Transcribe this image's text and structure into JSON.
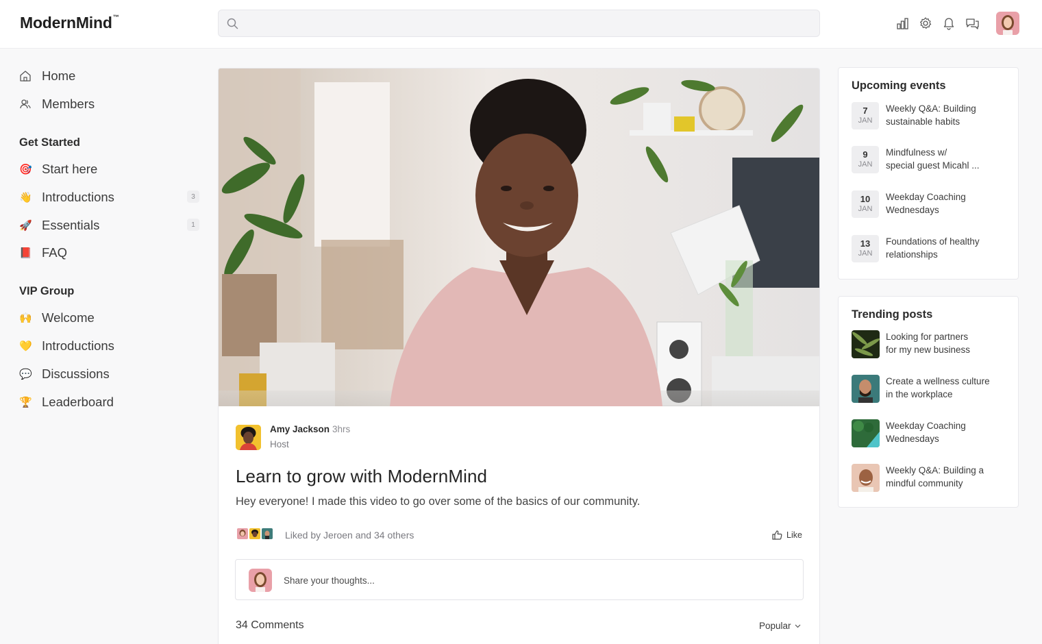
{
  "header": {
    "logo": "ModernMind",
    "logo_tm": "™",
    "search_placeholder": "",
    "icons": [
      "analytics-icon",
      "settings-icon",
      "notifications-icon",
      "messages-icon"
    ]
  },
  "sidebar": {
    "top_items": [
      {
        "label": "Home",
        "icon": "home-icon"
      },
      {
        "label": "Members",
        "icon": "members-icon"
      }
    ],
    "groups": [
      {
        "heading": "Get Started",
        "items": [
          {
            "label": "Start here",
            "icon": "🎯",
            "badge": ""
          },
          {
            "label": "Introductions",
            "icon": "👋",
            "badge": "3"
          },
          {
            "label": "Essentials",
            "icon": "🚀",
            "badge": "1"
          },
          {
            "label": "FAQ",
            "icon": "📕",
            "badge": ""
          }
        ]
      },
      {
        "heading": "VIP Group",
        "items": [
          {
            "label": "Welcome",
            "icon": "🙌",
            "badge": ""
          },
          {
            "label": "Introductions",
            "icon": "💛",
            "badge": ""
          },
          {
            "label": "Discussions",
            "icon": "💬",
            "badge": ""
          },
          {
            "label": "Leaderboard",
            "icon": "🏆",
            "badge": ""
          }
        ]
      }
    ]
  },
  "post": {
    "author_name": "Amy Jackson",
    "time": "3hrs",
    "role": "Host",
    "title": "Learn to grow with ModernMind",
    "body": "Hey everyone! I made this video to go over some of the basics of our community.",
    "likes_text": "Liked by Jeroen and 34 others",
    "like_label": "Like",
    "comment_placeholder": "Share your thoughts...",
    "comments_count": "34 Comments",
    "sort_label": "Popular"
  },
  "events": {
    "title": "Upcoming events",
    "items": [
      {
        "day": "7",
        "month": "JAN",
        "line1": "Weekly Q&A: Building",
        "line2": "sustainable habits"
      },
      {
        "day": "9",
        "month": "JAN",
        "line1": "Mindfulness w/",
        "line2": "special guest Micahl ..."
      },
      {
        "day": "10",
        "month": "JAN",
        "line1": "Weekday Coaching",
        "line2": "Wednesdays"
      },
      {
        "day": "13",
        "month": "JAN",
        "line1": "Foundations of healthy",
        "line2": "relationships"
      }
    ]
  },
  "trending": {
    "title": "Trending posts",
    "items": [
      {
        "line1": "Looking for partners",
        "line2": "for my new business"
      },
      {
        "line1": "Create a wellness culture",
        "line2": "in the workplace"
      },
      {
        "line1": "Weekday Coaching",
        "line2": "Wednesdays"
      },
      {
        "line1": "Weekly Q&A: Building a",
        "line2": "mindful community"
      }
    ]
  }
}
